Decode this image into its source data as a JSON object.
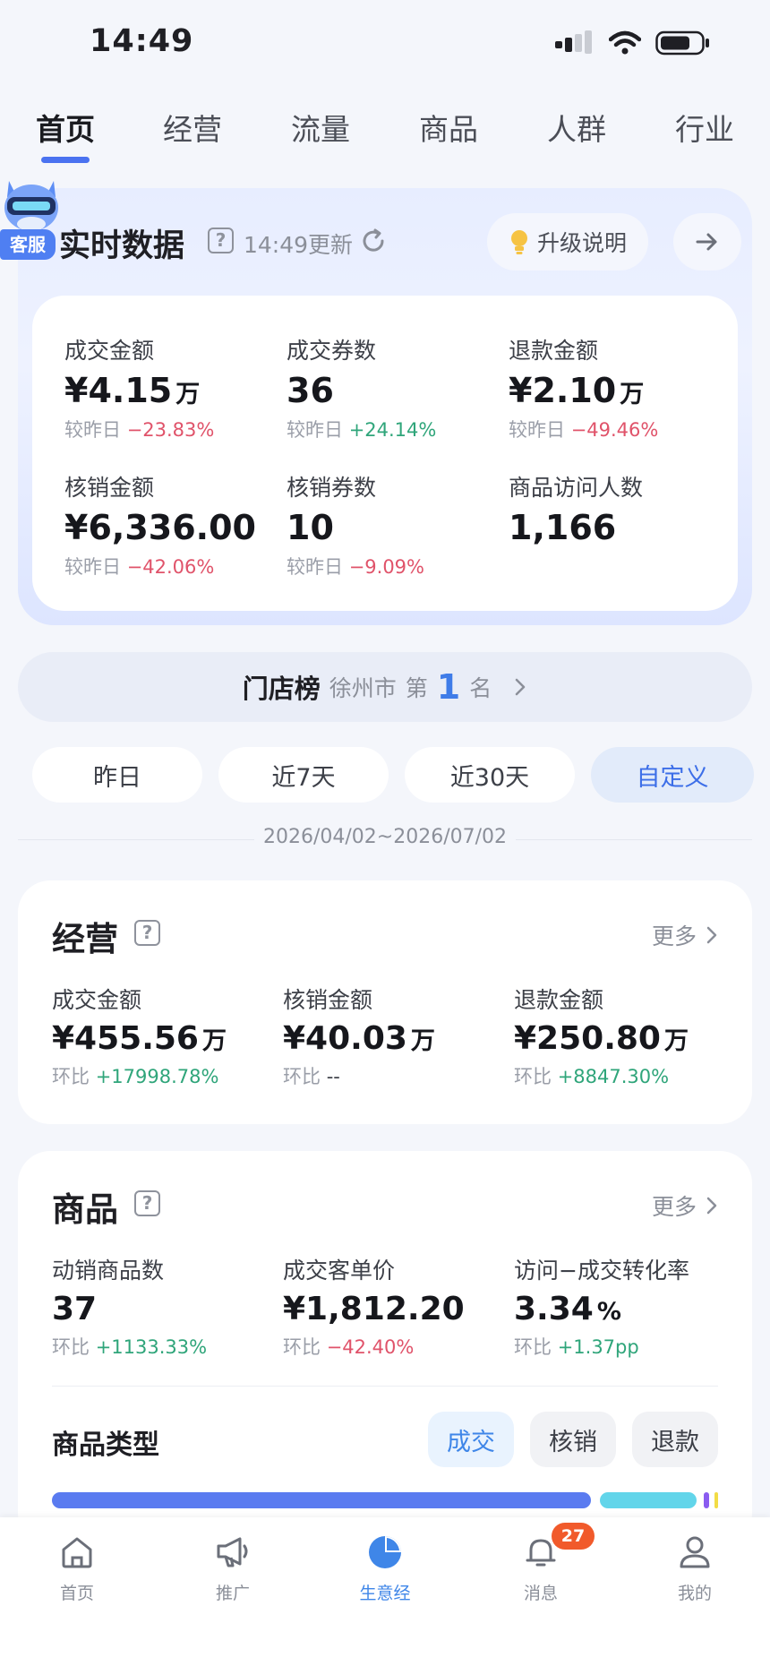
{
  "status_bar": {
    "time": "14:49"
  },
  "top_tabs": [
    "首页",
    "经营",
    "流量",
    "商品",
    "人群",
    "行业"
  ],
  "mascot": {
    "label": "客服"
  },
  "realtime": {
    "title": "实时数据",
    "update_time": "14:49更新",
    "upgrade_label": "升级说明",
    "metrics": [
      {
        "label": "成交金额",
        "value": "¥4.15",
        "unit": "万",
        "cmp_label": "较昨日",
        "cmp_value": "−23.83%",
        "trend": "neg"
      },
      {
        "label": "成交券数",
        "value": "36",
        "unit": "",
        "cmp_label": "较昨日",
        "cmp_value": "+24.14%",
        "trend": "pos"
      },
      {
        "label": "退款金额",
        "value": "¥2.10",
        "unit": "万",
        "cmp_label": "较昨日",
        "cmp_value": "−49.46%",
        "trend": "neg"
      },
      {
        "label": "核销金额",
        "value": "¥6,336.00",
        "unit": "",
        "cmp_label": "较昨日",
        "cmp_value": "−42.06%",
        "trend": "neg"
      },
      {
        "label": "核销券数",
        "value": "10",
        "unit": "",
        "cmp_label": "较昨日",
        "cmp_value": "−9.09%",
        "trend": "neg"
      },
      {
        "label": "商品访问人数",
        "value": "1,166",
        "unit": "",
        "cmp_label": "",
        "cmp_value": "",
        "trend": ""
      }
    ]
  },
  "store_rank": {
    "title": "门店榜",
    "city": "徐州市",
    "prefix": "第",
    "rank": "1",
    "suffix": "名"
  },
  "date_filters": [
    {
      "label": "昨日",
      "active": false
    },
    {
      "label": "近7天",
      "active": false
    },
    {
      "label": "近30天",
      "active": false
    },
    {
      "label": "自定义",
      "active": true
    }
  ],
  "date_range": "2026/04/02~2026/07/02",
  "business": {
    "title": "经营",
    "more": "更多",
    "metrics": [
      {
        "label": "成交金额",
        "value": "¥455.56",
        "unit": "万",
        "cmp_label": "环比",
        "cmp_value": "+17998.78%",
        "trend": "pos"
      },
      {
        "label": "核销金额",
        "value": "¥40.03",
        "unit": "万",
        "cmp_label": "环比",
        "cmp_value": "--",
        "trend": ""
      },
      {
        "label": "退款金额",
        "value": "¥250.80",
        "unit": "万",
        "cmp_label": "环比",
        "cmp_value": "+8847.30%",
        "trend": "pos"
      }
    ]
  },
  "goods": {
    "title": "商品",
    "more": "更多",
    "metrics": [
      {
        "label": "动销商品数",
        "value": "37",
        "unit": "",
        "cmp_label": "环比",
        "cmp_value": "+1133.33%",
        "trend": "pos"
      },
      {
        "label": "成交客单价",
        "value": "¥1,812.20",
        "unit": "",
        "cmp_label": "环比",
        "cmp_value": "−42.40%",
        "trend": "neg"
      },
      {
        "label": "访问−成交转化率",
        "value": "3.34",
        "unit": "%",
        "cmp_label": "环比",
        "cmp_value": "+1.37pp",
        "trend": "pos"
      }
    ],
    "type_title": "商品类型",
    "type_tabs": [
      {
        "label": "成交",
        "active": true
      },
      {
        "label": "核销",
        "active": false
      },
      {
        "label": "退款",
        "active": false
      }
    ],
    "type_bar_colors": [
      "#5a7bf0",
      "#62d5ea",
      "#8a5cf0",
      "#f2dc45"
    ]
  },
  "bottom_nav": {
    "items": [
      {
        "label": "首页",
        "active": false
      },
      {
        "label": "推广",
        "active": false
      },
      {
        "label": "生意经",
        "active": true
      },
      {
        "label": "消息",
        "active": false
      },
      {
        "label": "我的",
        "active": false
      }
    ],
    "message_badge": "27",
    "active_color": "#3f86e8"
  }
}
